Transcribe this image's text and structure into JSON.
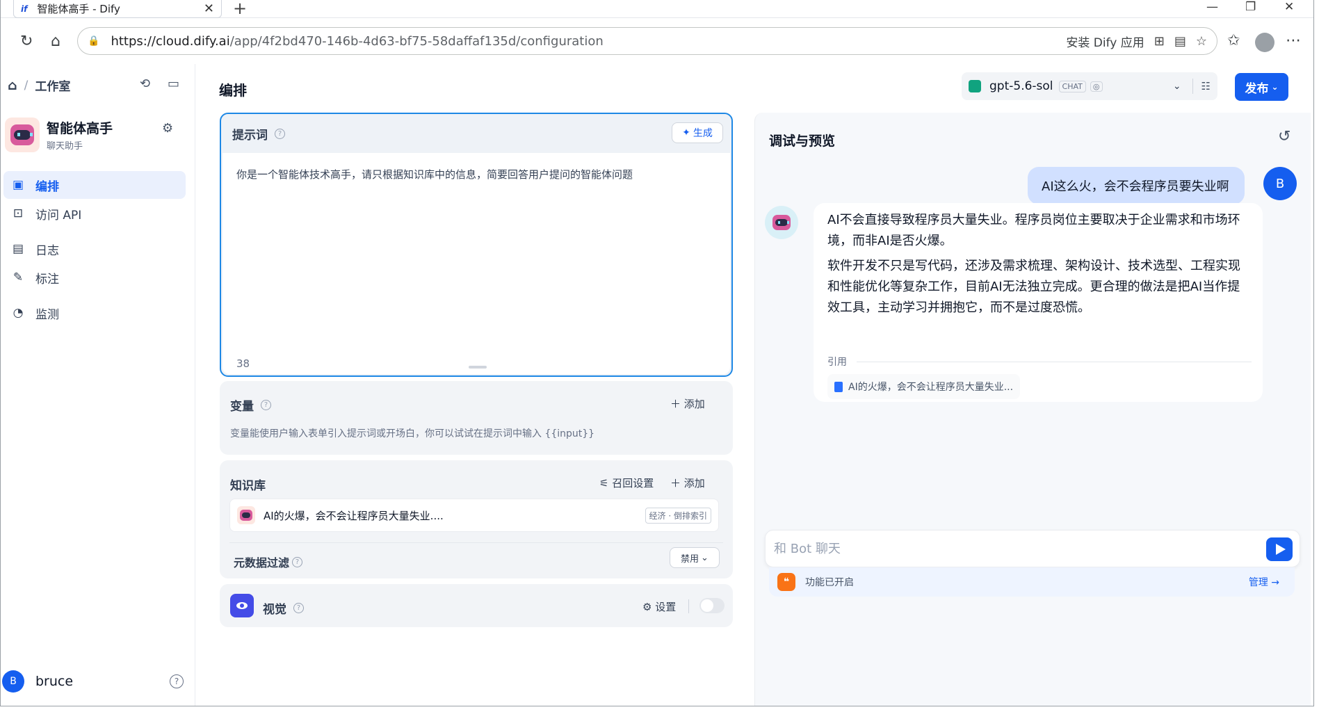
{
  "browser": {
    "tab_title": "智能体高手 - Dify",
    "tab_favicon": "if",
    "url_host": "https://cloud.dify.ai",
    "url_path": "/app/4f2bd470-146b-4d63-bf75-58daffaf135d/configuration",
    "install_label": "安装 Dify 应用"
  },
  "sidebar": {
    "breadcrumb": "工作室",
    "app_name": "智能体高手",
    "app_type": "聊天助手",
    "nav": [
      {
        "label": "编排",
        "icon": "layout-icon",
        "active": true
      },
      {
        "label": "访问 API",
        "icon": "terminal-icon"
      },
      {
        "label": "日志",
        "icon": "log-icon"
      },
      {
        "label": "标注",
        "icon": "annotation-icon"
      },
      {
        "label": "监测",
        "icon": "monitor-icon"
      }
    ],
    "user": {
      "initial": "B",
      "name": "bruce"
    }
  },
  "header": {
    "title": "编排",
    "model": {
      "name": "gpt-5.6-sol",
      "mode": "CHAT"
    },
    "publish_label": "发布"
  },
  "prompt": {
    "title": "提示词",
    "generate_label": "生成",
    "text": "你是一个智能体技术高手，请只根据知识库中的信息，简要回答用户提问的智能体问题",
    "char_count": "38"
  },
  "variables": {
    "title": "变量",
    "add_label": "添加",
    "description": "变量能使用户输入表单引入提示词或开场白，你可以试试在提示词中输入 {{input}}"
  },
  "knowledge": {
    "title": "知识库",
    "retrieval_label": "召回设置",
    "add_label": "添加",
    "item_name": "AI的火爆，会不会让程序员大量失业....",
    "item_tag": "经济 · 倒排索引",
    "metadata_label": "元数据过滤",
    "metadata_value": "禁用"
  },
  "vision": {
    "title": "视觉",
    "settings_label": "设置",
    "enabled": false
  },
  "debug": {
    "title": "调试与预览",
    "user_message": "AI这么火，会不会程序员要失业啊",
    "user_initial": "B",
    "bot_para1": "AI不会直接导致程序员大量失业。程序员岗位主要取决于企业需求和市场环境，而非AI是否火爆。",
    "bot_para2": "软件开发不只是写代码，还涉及需求梳理、架构设计、技术选型、工程实现和性能优化等复杂工作，目前AI无法独立完成。更合理的做法是把AI当作提效工具，主动学习并拥抱它，而不是过度恐慌。",
    "citation_label": "引用",
    "citation_item": "AI的火爆，会不会让程序员大量失业...",
    "input_placeholder": "和 Bot 聊天",
    "features_label": "功能已开启",
    "manage_label": "管理 →"
  },
  "colors": {
    "primary": "#155eef",
    "prompt_border": "#1e88e5",
    "vision": "#444ce7",
    "feature": "#f97316"
  }
}
